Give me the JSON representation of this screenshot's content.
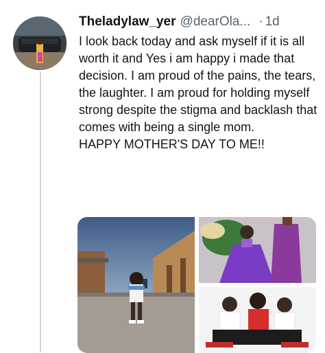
{
  "tweet": {
    "display_name": "Theladylaw_yer",
    "handle": "@dearOla...",
    "separator": "·",
    "time": "1d",
    "text_lines": [
      "I look back today and ask myself if it is all worth it and Yes i am happy i made that decision.  I am proud of the pains, the tears, the laughter. I am proud for holding myself strong despite the stigma and backlash that comes with being a single mom.",
      "HAPPY MOTHER'S DAY TO ME!!"
    ]
  },
  "media": {
    "photos": [
      "child-outdoors-photo",
      "girl-purple-dress-photo",
      "family-group-photo"
    ]
  }
}
